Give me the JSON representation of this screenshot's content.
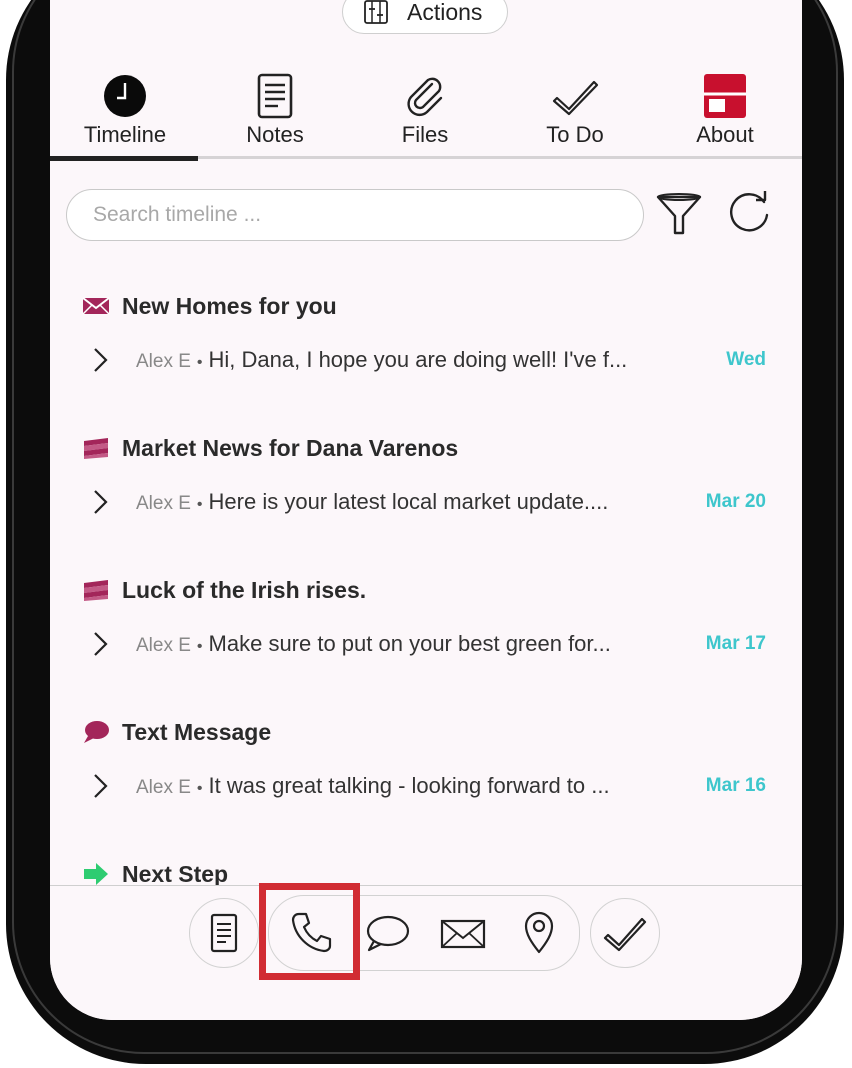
{
  "actions_label": "Actions",
  "tabs": [
    {
      "label": "Timeline",
      "icon": "clock-icon",
      "active": true
    },
    {
      "label": "Notes",
      "icon": "notes-icon"
    },
    {
      "label": "Files",
      "icon": "paperclip-icon"
    },
    {
      "label": "To Do",
      "icon": "checkmark-icon"
    },
    {
      "label": "About",
      "icon": "about-card-icon"
    }
  ],
  "search": {
    "placeholder": "Search timeline ..."
  },
  "timeline": [
    {
      "icon": "envelope-icon",
      "title": "New Homes for you",
      "sender": "Alex E",
      "message": "Hi, Dana, I hope you are doing well! I've f...",
      "date": "Wed"
    },
    {
      "icon": "newsletter-icon",
      "title": "Market News for Dana Varenos",
      "sender": "Alex E",
      "message": "Here is your latest local market update....",
      "date": "Mar 20"
    },
    {
      "icon": "newsletter-icon",
      "title": "Luck of the Irish rises.",
      "sender": "Alex E",
      "message": "Make sure to put on your best green for...",
      "date": "Mar 17"
    },
    {
      "icon": "speech-bubble-icon",
      "title": "Text Message",
      "sender": "Alex E",
      "message": "It was great talking - looking forward to ...",
      "date": "Mar 16"
    },
    {
      "icon": "arrow-right-icon",
      "title": "Next Step"
    }
  ],
  "bottom_actions": [
    "note-icon",
    "phone-icon",
    "chat-bubble-icon",
    "envelope-icon",
    "location-pin-icon",
    "checkmark-icon"
  ],
  "highlighted_action": "phone-icon",
  "colors": {
    "accent_magenta": "#a3265a",
    "about_red": "#c8102e",
    "date_teal": "#3ec6cc",
    "next_step_green": "#2ecc71",
    "highlight_red": "#d12c33",
    "screen_bg": "#fcf7fa"
  }
}
